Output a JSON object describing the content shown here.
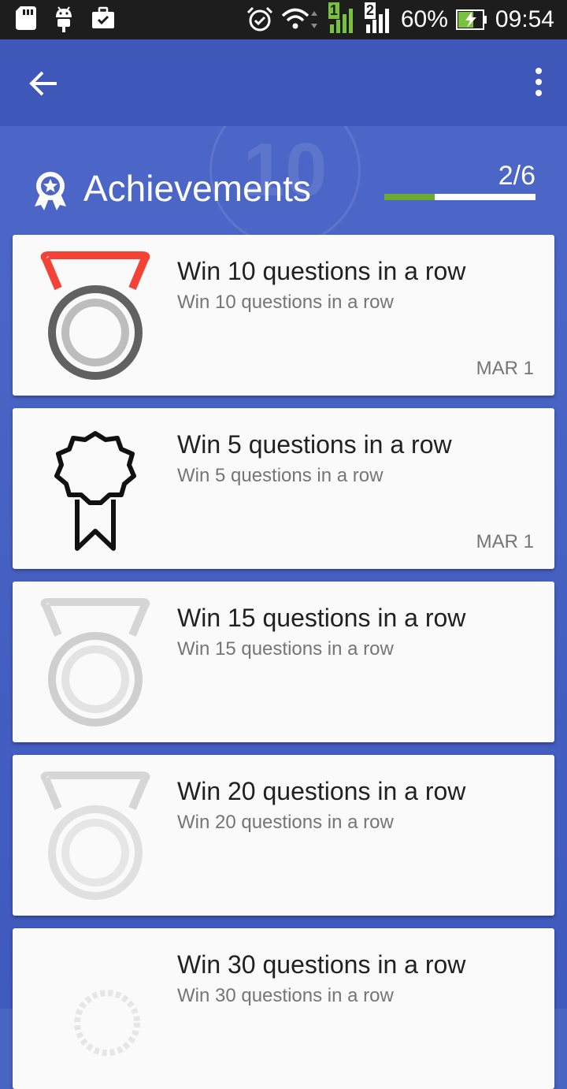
{
  "status_bar": {
    "battery": "60%",
    "time": "09:54",
    "sim1": "1",
    "sim2": "2",
    "icons": [
      "sd-card-icon",
      "android-icon",
      "briefcase-check-icon",
      "alarm-icon",
      "wifi-icon",
      "signal-icon",
      "battery-charging-icon"
    ]
  },
  "app_bar": {
    "back_icon": "arrow-back-icon",
    "menu_icon": "more-vert-icon"
  },
  "header": {
    "title": "Achievements",
    "icon": "award-ribbon-icon",
    "progress_text": "2/6",
    "progress_fraction": 0.333,
    "progress_color": "#6aaa2e",
    "ghost_number": "10"
  },
  "achievements": [
    {
      "title": "Win 10 questions in a row",
      "subtitle": "Win 10 questions in a row",
      "date": "MAR 1",
      "state": "unlocked",
      "icon": "medal-icon"
    },
    {
      "title": "Win 5 questions in a row",
      "subtitle": "Win 5 questions in a row",
      "date": "MAR 1",
      "state": "unlocked",
      "icon": "rosette-ribbon-icon"
    },
    {
      "title": "Win 15 questions in a row",
      "subtitle": "Win 15 questions in a row",
      "date": "",
      "state": "locked",
      "icon": "medal-icon"
    },
    {
      "title": "Win 20 questions in a row",
      "subtitle": "Win 20 questions in a row",
      "date": "",
      "state": "locked",
      "icon": "medal-icon"
    },
    {
      "title": "Win 30 questions in a row",
      "subtitle": "Win 30 questions in a row",
      "date": "",
      "state": "locked",
      "icon": "seal-icon"
    }
  ],
  "colors": {
    "app_bar": "#3f57b9",
    "background": "#4b66c6",
    "medal_ribbon_red": "#f44336",
    "card": "#fafafa"
  }
}
